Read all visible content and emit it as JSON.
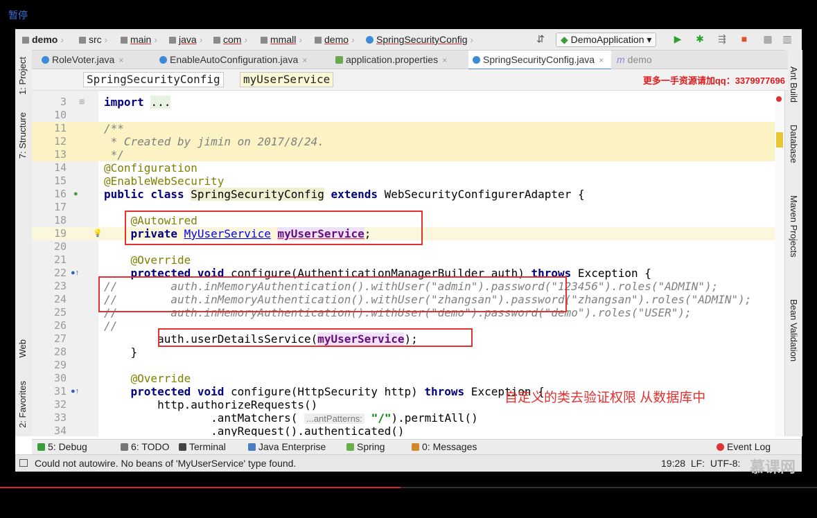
{
  "player": {
    "pause_label": "暂停",
    "progress": 0.49
  },
  "navbar": {
    "crumbs": [
      "demo",
      "src",
      "main",
      "java",
      "com",
      "mmall",
      "demo",
      "SpringSecurityConfig"
    ],
    "run_config": "DemoApplication"
  },
  "tabs": [
    {
      "label": "RoleVoter.java",
      "active": false
    },
    {
      "label": "EnableAutoConfiguration.java",
      "active": false
    },
    {
      "label": "application.properties",
      "active": false
    },
    {
      "label": "SpringSecurityConfig.java",
      "active": true
    },
    {
      "label": "demo",
      "active": false
    }
  ],
  "breadcrumb": {
    "class_chip": "SpringSecurityConfig",
    "member_chip": "myUserService"
  },
  "watermark": "更多一手资源请加qq：3379977696",
  "left_tools": [
    "1: Project",
    "7: Structure",
    "Web",
    "2: Favorites"
  ],
  "right_tools": [
    "Ant Build",
    "Database",
    "Maven Projects",
    "Bean Validation"
  ],
  "editor": {
    "lines": [
      {
        "n": "3",
        "text": "import ..."
      },
      {
        "n": "10",
        "text": ""
      },
      {
        "n": "11",
        "text": "/**"
      },
      {
        "n": "12",
        "text": " * Created by jimin on 2017/8/24."
      },
      {
        "n": "13",
        "text": " */"
      },
      {
        "n": "14",
        "text": "@Configuration"
      },
      {
        "n": "15",
        "text": "@EnableWebSecurity"
      },
      {
        "n": "16",
        "text": "public class SpringSecurityConfig extends WebSecurityConfigurerAdapter {"
      },
      {
        "n": "17",
        "text": ""
      },
      {
        "n": "18",
        "text": "    @Autowired"
      },
      {
        "n": "19",
        "text": "    private MyUserService myUserService;"
      },
      {
        "n": "20",
        "text": ""
      },
      {
        "n": "21",
        "text": "    @Override"
      },
      {
        "n": "22",
        "text": "    protected void configure(AuthenticationManagerBuilder auth) throws Exception {"
      },
      {
        "n": "23",
        "text": "//        auth.inMemoryAuthentication().withUser(\"admin\").password(\"123456\").roles(\"ADMIN\");"
      },
      {
        "n": "24",
        "text": "//        auth.inMemoryAuthentication().withUser(\"zhangsan\").password(\"zhangsan\").roles(\"ADMIN\");"
      },
      {
        "n": "25",
        "text": "//        auth.inMemoryAuthentication().withUser(\"demo\").password(\"demo\").roles(\"USER\");"
      },
      {
        "n": "26",
        "text": "//"
      },
      {
        "n": "27",
        "text": "        auth.userDetailsService(myUserService);"
      },
      {
        "n": "28",
        "text": "    }"
      },
      {
        "n": "29",
        "text": ""
      },
      {
        "n": "30",
        "text": "    @Override"
      },
      {
        "n": "31",
        "text": "    protected void configure(HttpSecurity http) throws Exception {"
      },
      {
        "n": "32",
        "text": "        http.authorizeRequests()"
      },
      {
        "n": "33",
        "text": "                .antMatchers(  antPatterns: \"/\").permitAll()"
      },
      {
        "n": "34",
        "text": "                .anyRequest().authenticated()"
      }
    ],
    "param_hint": "...antPatterns:",
    "annotation_zh": "自定义的类去验证权限  从数据库中"
  },
  "bottom_tools": [
    "5: Debug",
    "6: TODO",
    "Terminal",
    "Java Enterprise",
    "Spring",
    "0: Messages",
    "Event Log"
  ],
  "status": {
    "message": "Could not autowire. No beans of 'MyUserService' type found.",
    "position": "19:28",
    "line_sep": "LF:",
    "encoding": "UTF-8:"
  },
  "logo_text": "慕课网"
}
